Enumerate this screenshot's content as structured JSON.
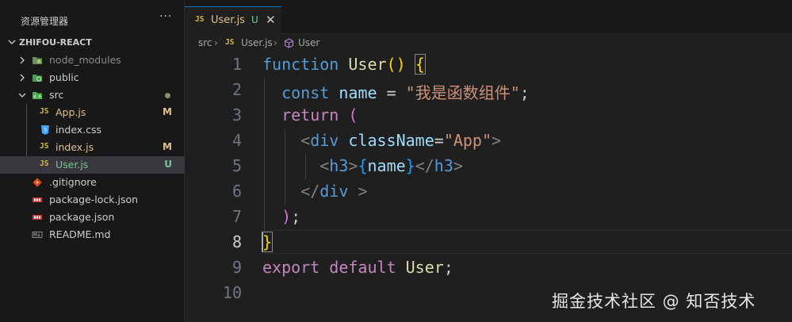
{
  "explorer": {
    "title": "资源管理器",
    "more": "···",
    "project": "ZHIFOU-REACT",
    "items": [
      {
        "name": "node_modules",
        "badge": ""
      },
      {
        "name": "public",
        "badge": ""
      },
      {
        "name": "src",
        "badge": ""
      },
      {
        "name": "App.js",
        "badge": "M"
      },
      {
        "name": "index.css",
        "badge": ""
      },
      {
        "name": "index.js",
        "badge": "M"
      },
      {
        "name": "User.js",
        "badge": "U"
      },
      {
        "name": ".gitignore",
        "badge": ""
      },
      {
        "name": "package-lock.json",
        "badge": ""
      },
      {
        "name": "package.json",
        "badge": ""
      },
      {
        "name": "README.md",
        "badge": ""
      }
    ]
  },
  "tab": {
    "icon": "JS",
    "name": "User.js",
    "status": "U",
    "close": "✕"
  },
  "breadcrumb": {
    "folder": "src",
    "sep": "›",
    "file_icon": "JS",
    "file": "User.js",
    "symbol": "User"
  },
  "editor": {
    "line_numbers": [
      "1",
      "2",
      "3",
      "4",
      "5",
      "6",
      "7",
      "8",
      "9",
      "10"
    ],
    "active_line": "8"
  },
  "watermark": "掘金技术社区 @ 知否技术",
  "colors": {
    "accent": "#0078d4",
    "modified": "#e2c08d",
    "untracked": "#73c991"
  }
}
